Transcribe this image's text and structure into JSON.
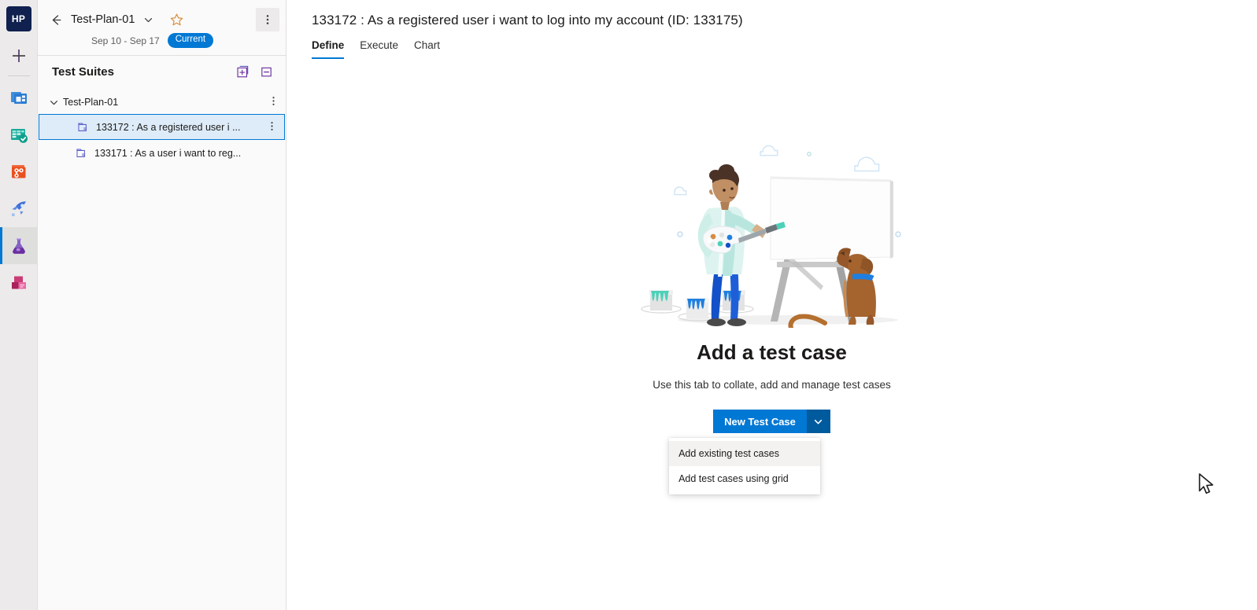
{
  "rail": {
    "logo_label": "HP",
    "items": [
      {
        "name": "new-item",
        "label": "New",
        "icon": "plus-icon"
      },
      {
        "name": "overview",
        "label": "Overview",
        "icon": "overview-icon",
        "active": false
      },
      {
        "name": "boards",
        "label": "Boards",
        "icon": "boards-icon",
        "active": false
      },
      {
        "name": "repos",
        "label": "Repos",
        "icon": "repos-icon",
        "active": false
      },
      {
        "name": "pipelines",
        "label": "Pipelines",
        "icon": "pipelines-icon",
        "active": false
      },
      {
        "name": "test-plans",
        "label": "Test Plans",
        "icon": "flask-icon",
        "active": true
      },
      {
        "name": "artifacts",
        "label": "Artifacts",
        "icon": "artifacts-icon",
        "active": false
      }
    ]
  },
  "pane": {
    "back_icon": "back-arrow-icon",
    "plan_title": "Test-Plan-01",
    "plan_chevron_icon": "chevron-down-icon",
    "favorite_icon": "star-outline-icon",
    "more_icon": "more-vertical-icon",
    "date_range": "Sep 10 - Sep 17",
    "badge": "Current",
    "suites_header": "Test Suites",
    "new_suite_icon": "new-suite-icon",
    "collapse_all_icon": "collapse-all-icon",
    "tree": [
      {
        "label": "Test-Plan-01",
        "level": "root",
        "expanded": true,
        "chevron_icon": "chevron-down-icon",
        "selected": false,
        "more_icon": "more-vertical-icon"
      },
      {
        "label": "133172 : As a registered user i ...",
        "level": "child",
        "icon": "requirement-suite-icon",
        "selected": true,
        "more_icon": "more-vertical-icon"
      },
      {
        "label": "133171 : As a user i want to reg...",
        "level": "child",
        "icon": "requirement-suite-icon",
        "selected": false,
        "more_icon": ""
      }
    ]
  },
  "main": {
    "title": "133172 : As a registered user i want to log into my account (ID: 133175)",
    "tabs": [
      {
        "label": "Define",
        "active": true
      },
      {
        "label": "Execute",
        "active": false
      },
      {
        "label": "Chart",
        "active": false
      }
    ],
    "empty_state": {
      "illustration": "painter-easel-dog-illustration",
      "heading": "Add a test case",
      "subtext": "Use this tab to collate, add and manage test cases"
    },
    "new_test_case": {
      "label": "New Test Case",
      "arrow_icon": "chevron-down-icon",
      "menu_open": true,
      "menu_items": [
        {
          "label": "Add existing test cases",
          "hovered": true
        },
        {
          "label": "Add test cases using grid",
          "hovered": false
        }
      ]
    },
    "cursor_icon": "mouse-pointer-icon"
  },
  "colors": {
    "accent": "#0078d4",
    "accent_dark": "#005a9e",
    "selected_row_bg": "#deecf9",
    "rail_bg": "#eceaea",
    "pane_bg": "#fafafa"
  }
}
